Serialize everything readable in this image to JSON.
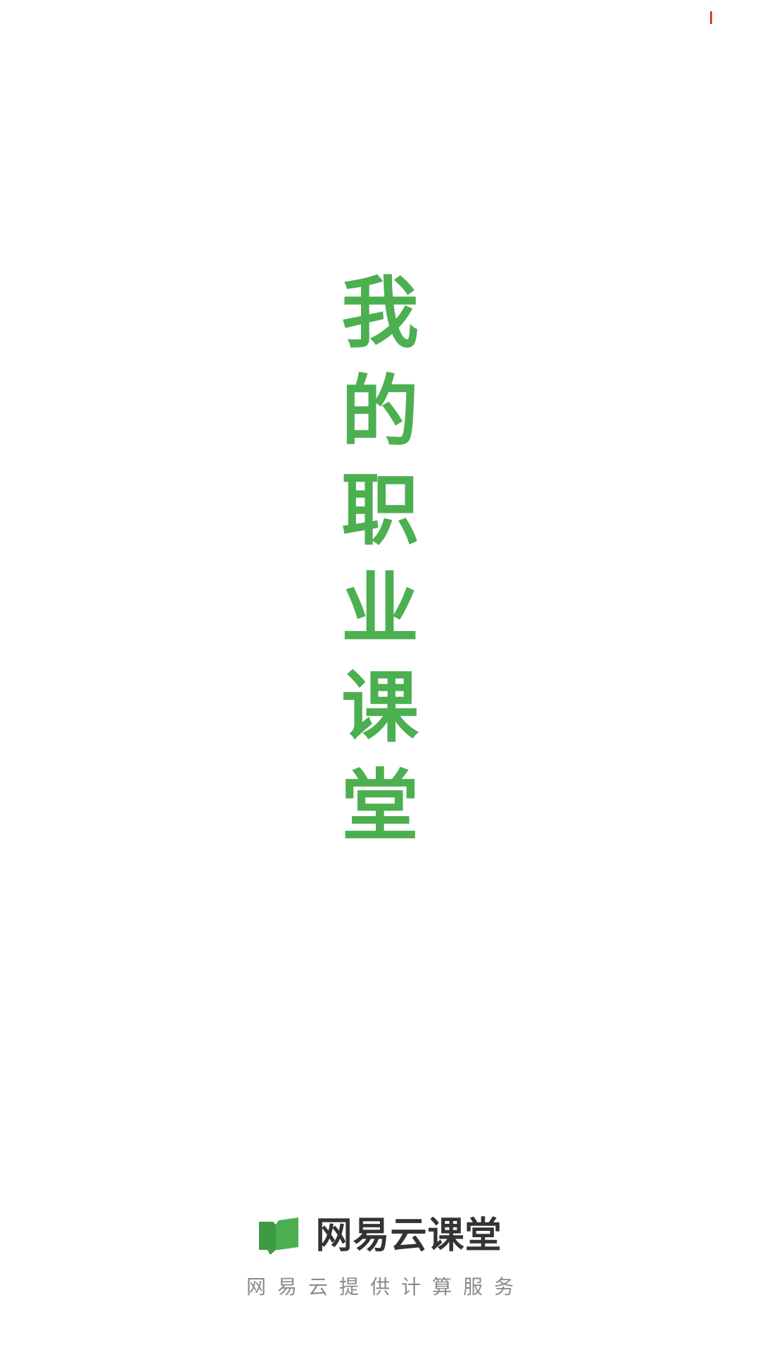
{
  "slogan": {
    "chars": [
      "我",
      "的",
      "职",
      "业",
      "课",
      "堂"
    ]
  },
  "brand": {
    "name": "网易云课堂",
    "tagline": "网易云提供计算服务",
    "icon": "book-chat-icon"
  },
  "colors": {
    "accent": "#4caf50",
    "brand_text": "#333333",
    "tagline_text": "#8a8a8a",
    "status_mark": "#e53935"
  }
}
